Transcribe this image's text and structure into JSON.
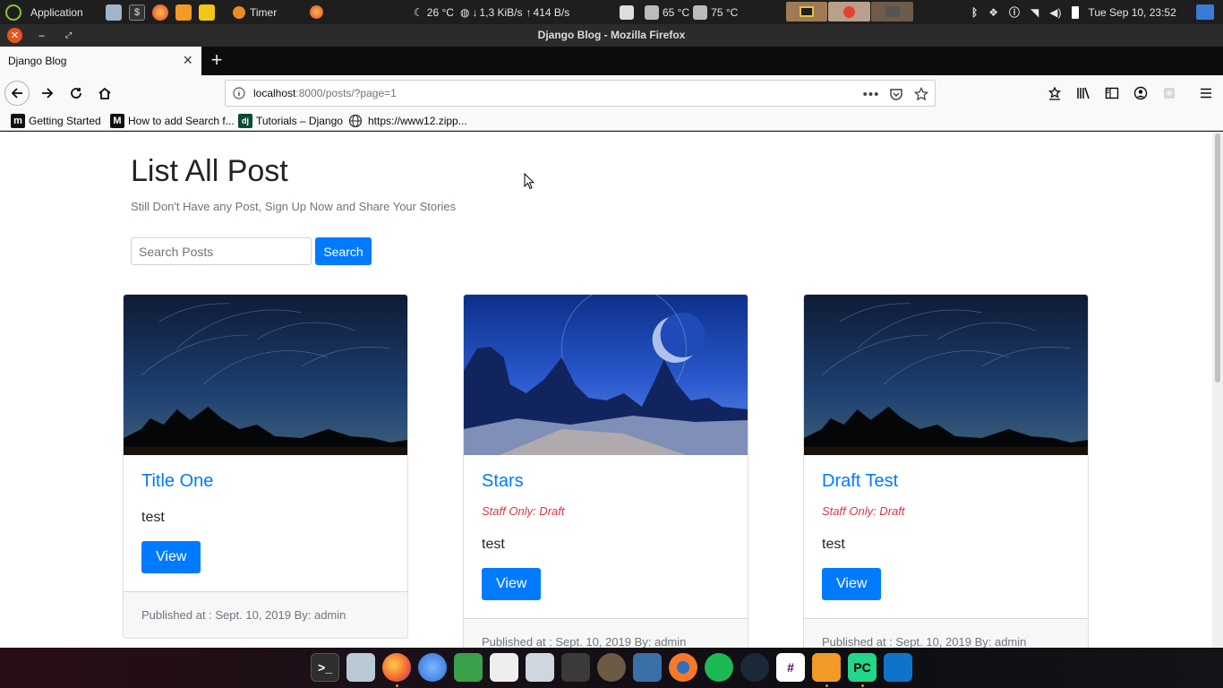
{
  "system_panel": {
    "app_menu": "Application",
    "timer": "Timer",
    "weather": "26 °C",
    "net_down": "1,3 KiB/s",
    "net_up": "414 B/s",
    "temp1": "65 °C",
    "temp2": "75 °C",
    "clock": "Tue Sep 10, 23:52"
  },
  "window": {
    "title": "Django Blog - Mozilla Firefox"
  },
  "tabs": [
    {
      "label": "Django Blog"
    }
  ],
  "urlbar": {
    "host": "localhost",
    "rest": ":8000/posts/?page=1"
  },
  "bookmarks": [
    {
      "label": "Getting Started",
      "icon": "m"
    },
    {
      "label": "How to add Search f...",
      "icon": "M"
    },
    {
      "label": "Tutorials – Django",
      "icon": "dj"
    },
    {
      "label": "https://www12.zipp...",
      "icon": "globe-icon"
    }
  ],
  "page": {
    "heading": "List All Post",
    "subtitle": "Still Don't Have any Post, Sign Up Now and Share Your Stories",
    "search_placeholder": "Search Posts",
    "search_button": "Search"
  },
  "posts": [
    {
      "title": "Title One",
      "draft": "",
      "text": "test",
      "button": "View",
      "footer": "Published at : Sept. 10, 2019 By: admin",
      "image": "night-sky-trees"
    },
    {
      "title": "Stars",
      "draft": "Staff Only: Draft",
      "text": "test",
      "button": "View",
      "footer": "Published at : Sept. 10, 2019 By: admin",
      "image": "alien-landscape"
    },
    {
      "title": "Draft Test",
      "draft": "Staff Only: Draft",
      "text": "test",
      "button": "View",
      "footer": "Published at : Sept. 10, 2019 By: admin",
      "image": "night-sky-trees"
    }
  ],
  "colors": {
    "primary": "#007bff",
    "draft": "#dc3545",
    "panel": "#1e1e1e"
  }
}
